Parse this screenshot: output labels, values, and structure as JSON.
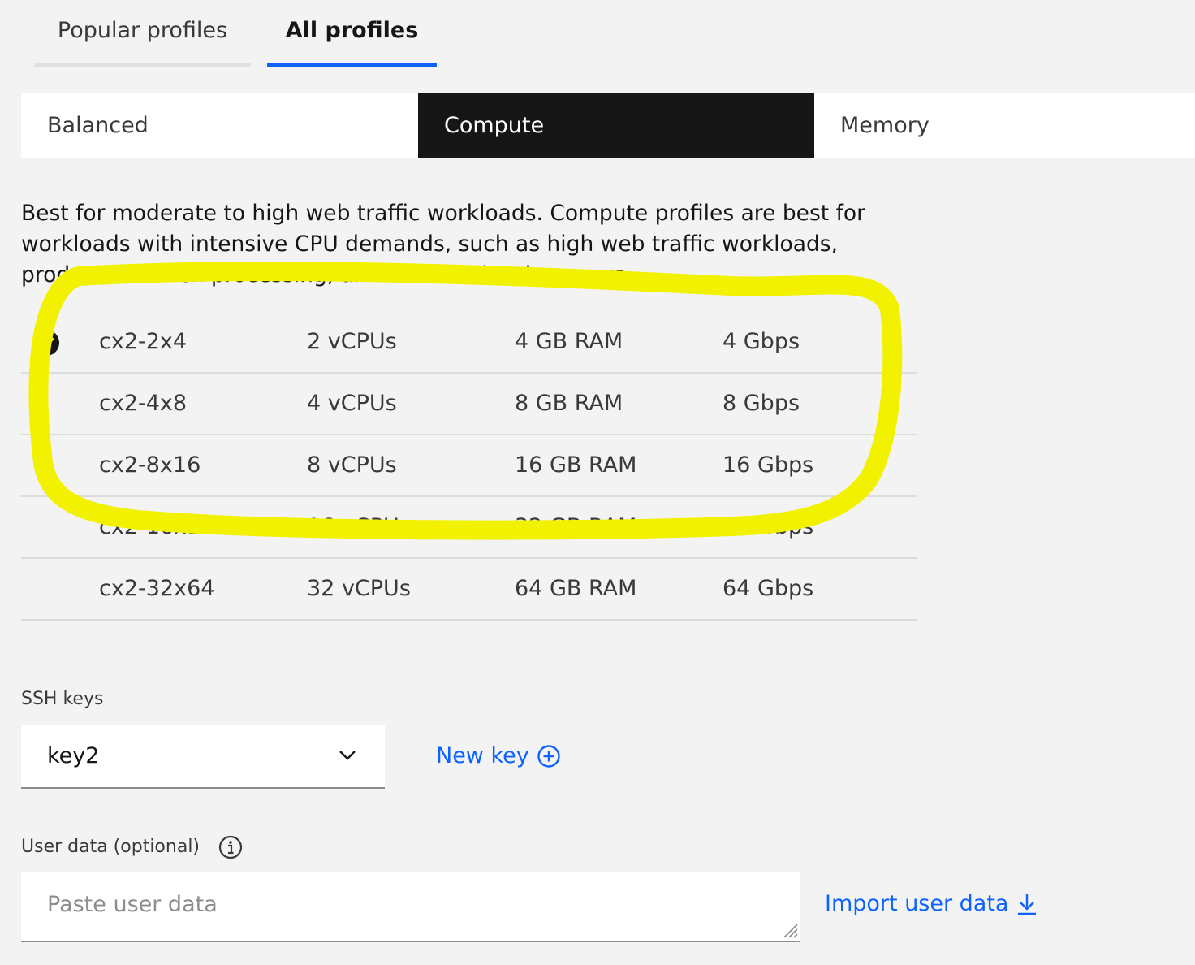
{
  "tabs": [
    {
      "label": "Popular profiles",
      "selected": false
    },
    {
      "label": "All profiles",
      "selected": true
    }
  ],
  "switcher": {
    "options": [
      "Balanced",
      "Compute",
      "Memory"
    ],
    "selected": "Compute"
  },
  "description": "Best for moderate to high web traffic workloads. Compute profiles are best for workloads with intensive CPU demands, such as high web traffic workloads, production batch processing, and front-end web servers.",
  "profiles": [
    {
      "name": "cx2-2x4",
      "vcpu": "2 vCPUs",
      "ram": "4 GB RAM",
      "bandwidth": "4 Gbps",
      "selected": true
    },
    {
      "name": "cx2-4x8",
      "vcpu": "4 vCPUs",
      "ram": "8 GB RAM",
      "bandwidth": "8 Gbps",
      "selected": false
    },
    {
      "name": "cx2-8x16",
      "vcpu": "8 vCPUs",
      "ram": "16 GB RAM",
      "bandwidth": "16 Gbps",
      "selected": false
    },
    {
      "name": "cx2-16x32",
      "vcpu": "16 vCPUs",
      "ram": "32 GB RAM",
      "bandwidth": "32 Gbps",
      "selected": false
    },
    {
      "name": "cx2-32x64",
      "vcpu": "32 vCPUs",
      "ram": "64 GB RAM",
      "bandwidth": "64 Gbps",
      "selected": false
    }
  ],
  "ssh": {
    "label": "SSH keys",
    "selected_value": "key2",
    "new_key_label": "New key"
  },
  "user_data": {
    "label": "User data (optional)",
    "placeholder": "Paste user data",
    "import_label": "Import user data"
  },
  "icons": {
    "selected_profile": "checkmark-filled-icon",
    "dropdown": "chevron-down-icon",
    "new_key": "add-circle-icon",
    "user_data_info": "information-icon",
    "import": "download-icon"
  },
  "colors": {
    "accent": "#0f62fe",
    "selected_switch_bg": "#161616",
    "highlight_annotation": "#f2f200",
    "background": "#f3f3f3"
  }
}
